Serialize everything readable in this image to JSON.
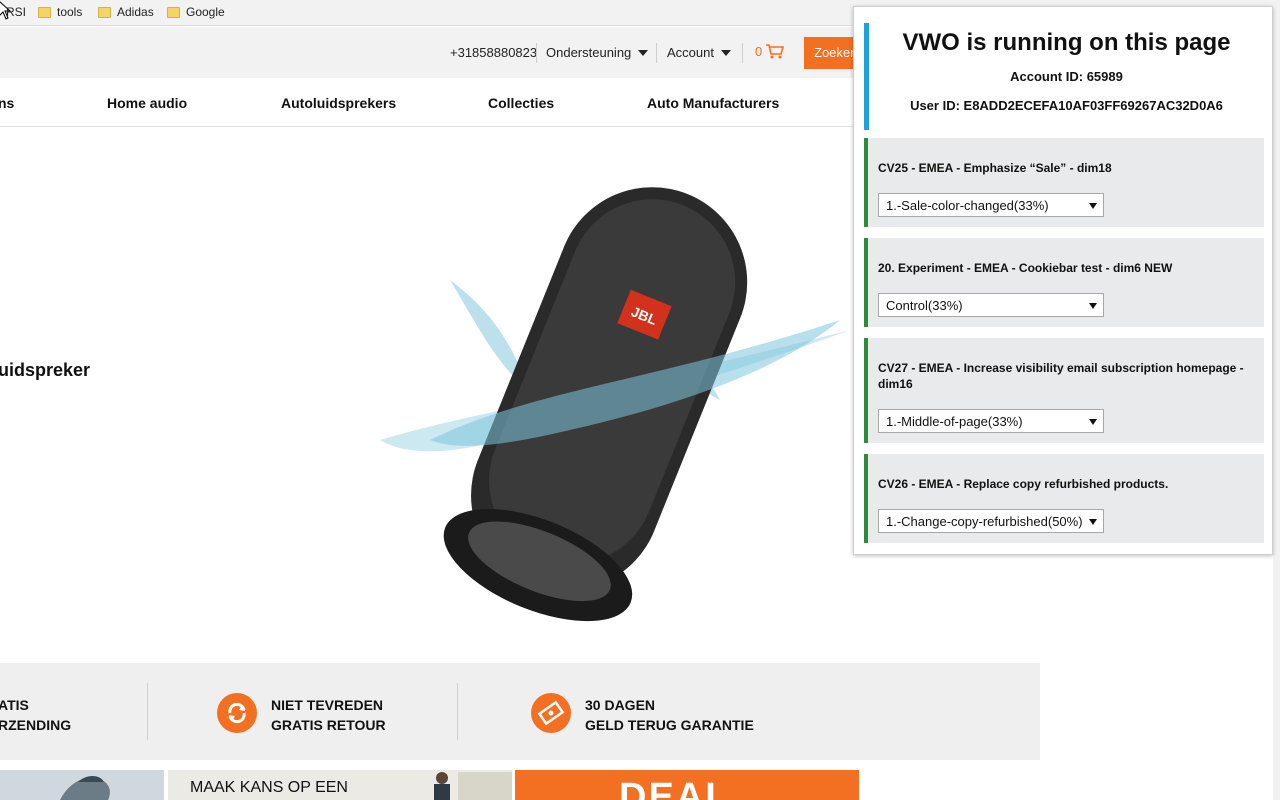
{
  "bookmarks": [
    {
      "label": "RSI"
    },
    {
      "label": "tools"
    },
    {
      "label": "Adidas"
    },
    {
      "label": "Google"
    }
  ],
  "utility": {
    "phone": "+31858880823",
    "support": "Ondersteuning",
    "account": "Account",
    "cart_count": "0",
    "search_button": "Zoeken"
  },
  "nav": [
    "ns",
    "Home audio",
    "Autoluidsprekers",
    "Collecties",
    "Auto Manufacturers"
  ],
  "hero": {
    "title": "uidspreker",
    "logo_text": "JBL"
  },
  "usp": [
    {
      "line1": "ATIS",
      "line2": "RZENDING"
    },
    {
      "line1": "NIET TEVREDEN",
      "line2": "GRATIS RETOUR"
    },
    {
      "line1": "30 DAGEN",
      "line2": "GELD TERUG GARANTIE"
    }
  ],
  "banners": {
    "middle_text": "MAAK KANS OP EEN",
    "deal_text": "DEAL"
  },
  "vwo": {
    "title": "VWO is running on this page",
    "account_label": "Account ID: 65989",
    "user_label": "User ID: E8ADD2ECEFA10AF03FF69267AC32D0A6",
    "campaigns": [
      {
        "name": "CV25 - EMEA - Emphasize “Sale” - dim18",
        "variation": "1.-Sale-color-changed(33%)"
      },
      {
        "name": "20. Experiment - EMEA - Cookiebar test - dim6 NEW",
        "variation": "Control(33%)"
      },
      {
        "name": "CV27 - EMEA - Increase visibility email subscription homepage - dim16",
        "variation": "1.-Middle-of-page(33%)"
      },
      {
        "name": "CV26 - EMEA - Replace copy refurbished products.",
        "variation": "1.-Change-copy-refurbished(50%)"
      }
    ]
  },
  "colors": {
    "brand_orange": "#f36f21",
    "vwo_blue": "#1fa1dc",
    "vwo_green": "#2e8b3a"
  }
}
